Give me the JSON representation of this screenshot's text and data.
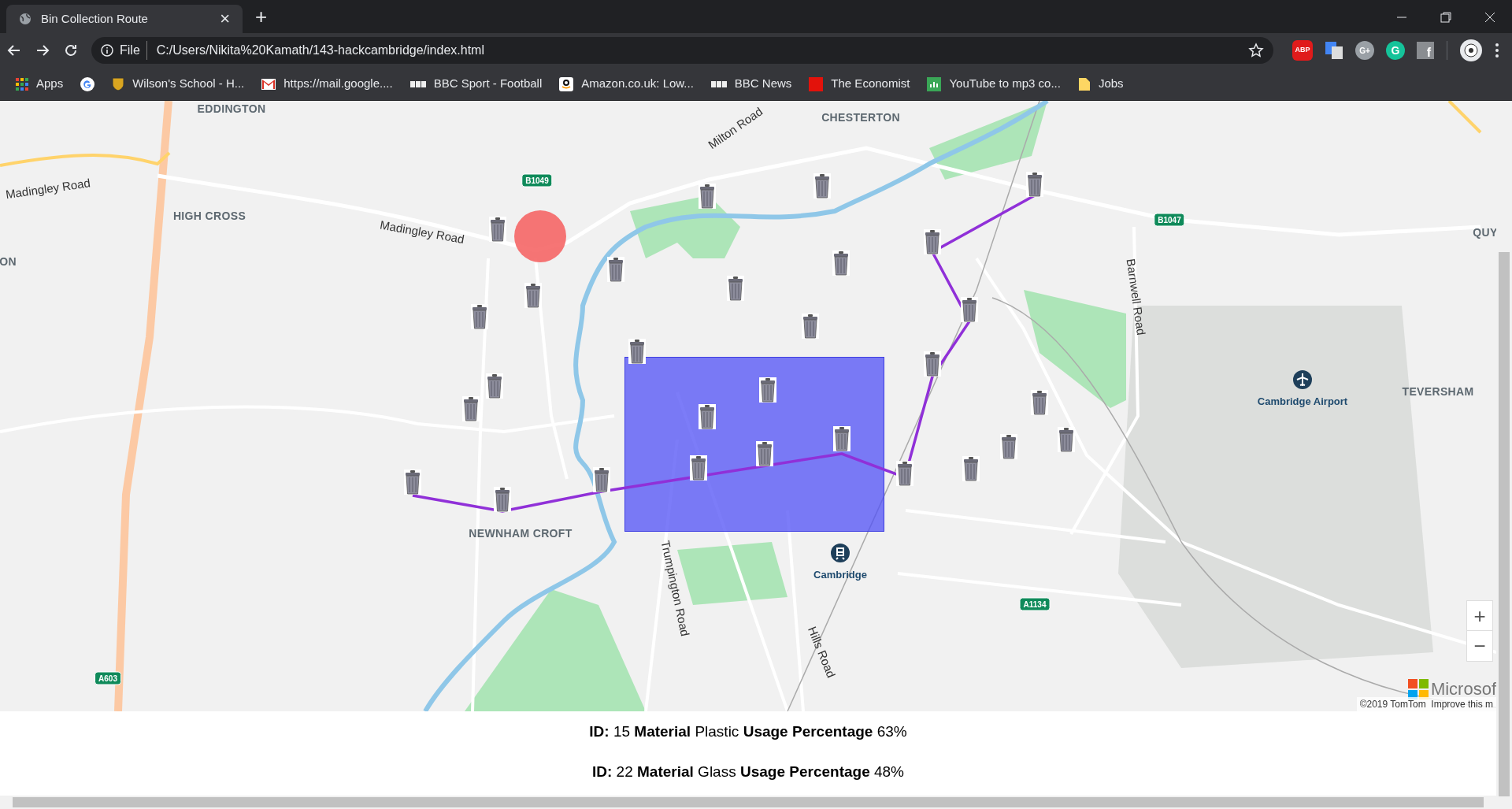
{
  "browser": {
    "tab": {
      "title": "Bin Collection Route",
      "close": "×"
    },
    "new_tab": "+",
    "address": {
      "scheme": "File",
      "url": "C:/Users/Nikita%20Kamath/143-hackcambridge/index.html"
    },
    "extensions": [
      {
        "kind": "abp",
        "glyph": "ABP"
      },
      {
        "kind": "translate"
      },
      {
        "kind": "gplus",
        "glyph": "G+"
      },
      {
        "kind": "grammarly",
        "glyph": "G"
      },
      {
        "kind": "facebook",
        "glyph": "f"
      }
    ],
    "bookmarks": [
      {
        "kind": "apps",
        "label": "Apps"
      },
      {
        "kind": "google"
      },
      {
        "kind": "shield",
        "label": "Wilson's School - H..."
      },
      {
        "kind": "gmail",
        "label": "https://mail.google...."
      },
      {
        "kind": "bbc",
        "label": "BBC Sport - Football"
      },
      {
        "kind": "amazon",
        "label": "Amazon.co.uk: Low..."
      },
      {
        "kind": "bbc",
        "label": "BBC News"
      },
      {
        "kind": "red",
        "label": "The Economist"
      },
      {
        "kind": "sheet",
        "label": "YouTube to mp3 co..."
      },
      {
        "kind": "folder",
        "label": "Jobs"
      }
    ]
  },
  "map": {
    "labels": [
      {
        "kind": "area",
        "text": "EDDINGTON"
      },
      {
        "kind": "road",
        "text": "Madingley Road"
      },
      {
        "kind": "area",
        "text": "HIGH CROSS"
      },
      {
        "kind": "area",
        "text": "ON"
      },
      {
        "kind": "road",
        "text": "Madingley Road"
      },
      {
        "kind": "shield",
        "text": "B1049"
      },
      {
        "kind": "road",
        "text": "Milton Road"
      },
      {
        "kind": "area",
        "text": "CHESTERTON"
      },
      {
        "kind": "shield",
        "text": "B1047"
      },
      {
        "kind": "area",
        "text": "QUY"
      },
      {
        "kind": "road",
        "text": "Barnwell Road"
      },
      {
        "kind": "poi",
        "text": "Cambridge Airport"
      },
      {
        "kind": "area",
        "text": "TEVERSHAM"
      },
      {
        "kind": "area",
        "text": "NEWNHAM CROFT"
      },
      {
        "kind": "poi",
        "text": "Cambridge"
      },
      {
        "kind": "road",
        "text": "Trumpington Road"
      },
      {
        "kind": "road",
        "text": "Hills Road"
      },
      {
        "kind": "shield",
        "text": "A1134"
      },
      {
        "kind": "shield",
        "text": "A603"
      }
    ],
    "zoom_in": "+",
    "zoom_out": "−",
    "brand": "Microsof",
    "attribution": "©2019 TomTom  Improve this m"
  },
  "details": [
    "**ID:** 15 **Material** Plastic **Usage Percentage** 63%",
    "**ID:** 22 **Material** Glass **Usage Percentage** 48%"
  ]
}
